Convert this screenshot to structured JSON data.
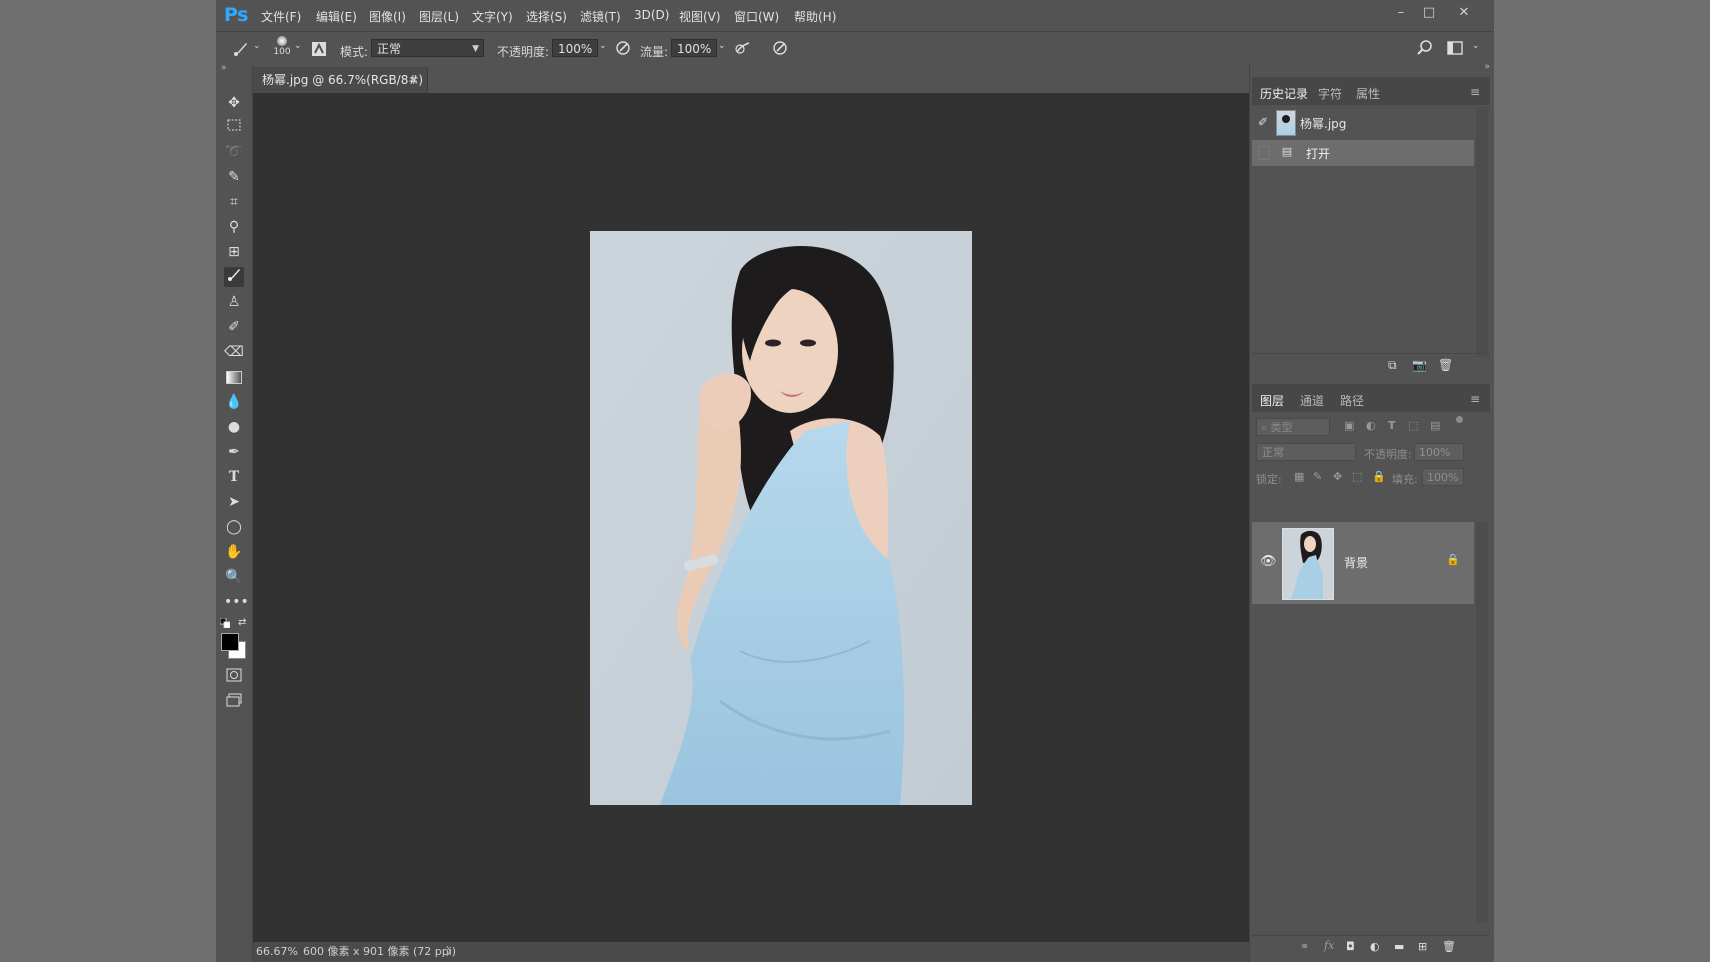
{
  "app": {
    "logo": "Ps"
  },
  "menu": [
    "文件(F)",
    "编辑(E)",
    "图像(I)",
    "图层(L)",
    "文字(Y)",
    "选择(S)",
    "滤镜(T)",
    "3D(D)",
    "视图(V)",
    "窗口(W)",
    "帮助(H)"
  ],
  "window_controls": {
    "minimize": "–",
    "maximize": "□",
    "close": "✕"
  },
  "options": {
    "brush_size": "100",
    "mode_label": "模式:",
    "mode_value": "正常",
    "opacity_label": "不透明度:",
    "opacity_value": "100%",
    "flow_label": "流量:",
    "flow_value": "100%"
  },
  "document": {
    "tab_title": "杨幂.jpg @ 66.7%(RGB/8#)",
    "tab_close": "×",
    "zoom": "66.67%",
    "doc_info": "600 像素 x 901 像素 (72 ppi)",
    "status_arrow": "〉"
  },
  "history_panel": {
    "tabs": [
      "历史记录",
      "字符",
      "属性"
    ],
    "snapshot_name": "杨幂.jpg",
    "steps": [
      "打开"
    ]
  },
  "layers_panel": {
    "tabs": [
      "图层",
      "通道",
      "路径"
    ],
    "filter_placeholder": "类型",
    "blend_mode": "正常",
    "opacity_label": "不透明度:",
    "opacity_value": "100%",
    "lock_label": "锁定:",
    "fill_label": "填充:",
    "fill_value": "100%",
    "layers": [
      {
        "name": "背景",
        "visible": true,
        "locked": true
      }
    ]
  },
  "colors": {
    "accent": "#31a8ff",
    "panel_bg": "#535353",
    "canvas_bg": "#323232",
    "photo_bg": "#c7d0d8",
    "dress": "#a9cfe6",
    "hair": "#1c1a1b",
    "skin": "#eccdb9"
  }
}
